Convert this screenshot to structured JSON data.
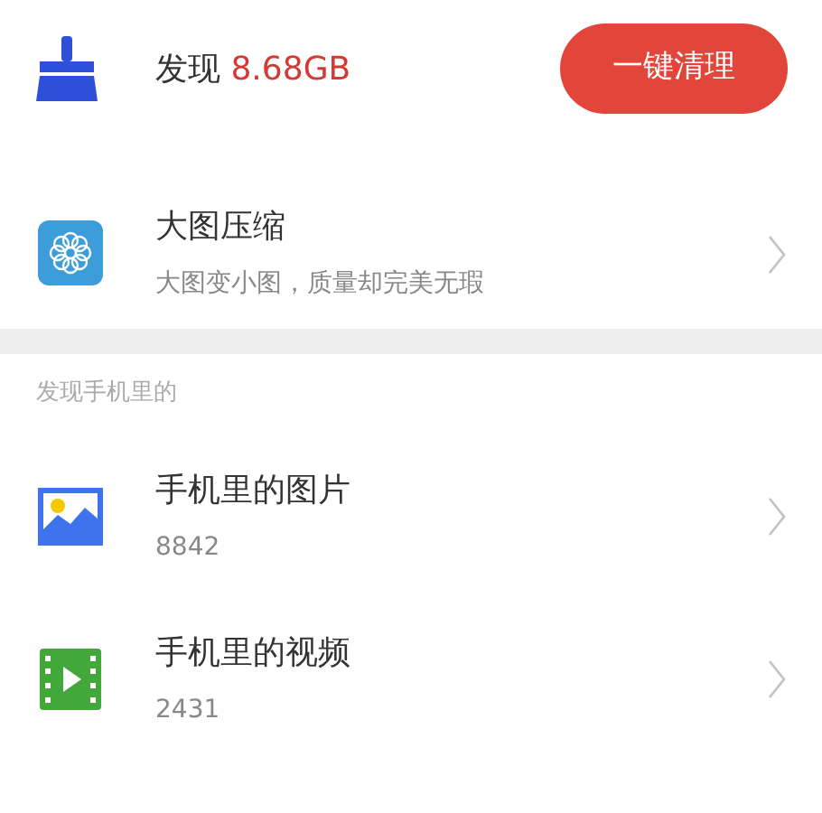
{
  "header": {
    "label": "发现",
    "size": "8.68GB",
    "button": "一键清理"
  },
  "feature": {
    "kind": "compress",
    "title": "大图压缩",
    "subtitle": "大图变小图，质量却完美无瑕"
  },
  "section": {
    "title": "发现手机里的",
    "items": [
      {
        "kind": "photo",
        "title": "手机里的图片",
        "count": "8842"
      },
      {
        "kind": "video",
        "title": "手机里的视频",
        "count": "2431"
      }
    ]
  }
}
